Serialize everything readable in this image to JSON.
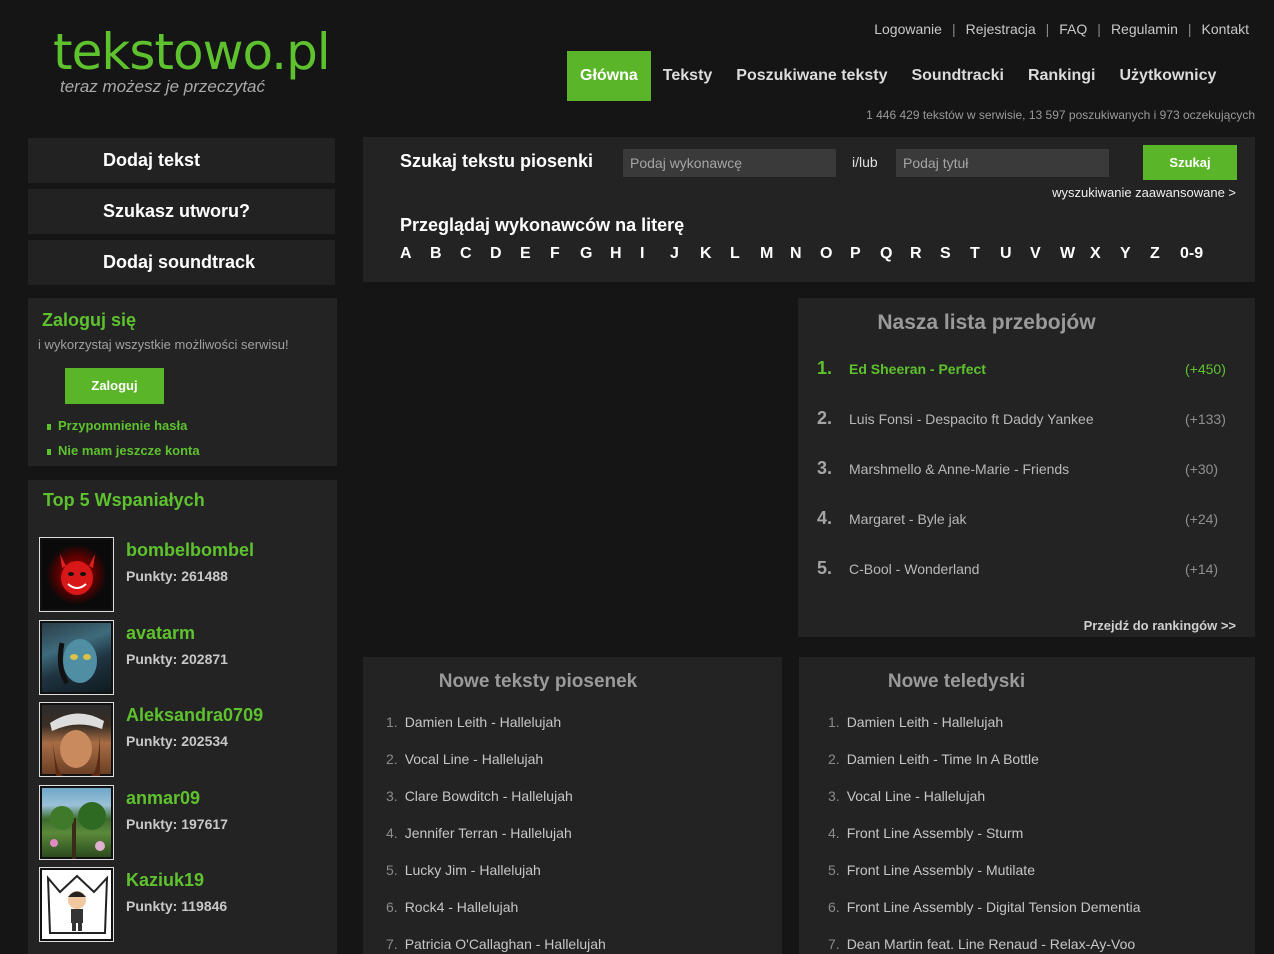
{
  "logo": {
    "title": "tekstowo.pl",
    "subtitle": "teraz możesz je przeczytać"
  },
  "toplinks": [
    "Logowanie",
    "Rejestracja",
    "FAQ",
    "Regulamin",
    "Kontakt"
  ],
  "nav": [
    "Główna",
    "Teksty",
    "Poszukiwane teksty",
    "Soundtracki",
    "Rankingi",
    "Użytkownicy"
  ],
  "stats": "1 446 429 tekstów w serwisie, 13 597 poszukiwanych i 973 oczekujących",
  "sidebar": {
    "buttons": [
      "Dodaj tekst",
      "Szukasz utworu?",
      "Dodaj soundtrack"
    ],
    "login": {
      "title": "Zaloguj się",
      "desc": "i wykorzystaj wszystkie możliwości serwisu!",
      "button": "Zaloguj",
      "links": [
        "Przypomnienie hasła",
        "Nie mam jeszcze konta"
      ]
    },
    "top5": {
      "title": "Top 5 Wspaniałych",
      "users": [
        {
          "name": "bombelbombel",
          "points": "Punkty: 261488"
        },
        {
          "name": "avatarm",
          "points": "Punkty: 202871"
        },
        {
          "name": "Aleksandra0709",
          "points": "Punkty: 202534"
        },
        {
          "name": "anmar09",
          "points": "Punkty: 197617"
        },
        {
          "name": "Kaziuk19",
          "points": "Punkty: 119846"
        }
      ]
    }
  },
  "search": {
    "title": "Szukaj tekstu piosenki",
    "artist_placeholder": "Podaj wykonawcę",
    "andor": "i/lub",
    "title_placeholder": "Podaj tytuł",
    "button": "Szukaj",
    "advanced": "wyszukiwanie zaawansowane >",
    "browse_title": "Przeglądaj wykonawców na literę",
    "letters": [
      "A",
      "B",
      "C",
      "D",
      "E",
      "F",
      "G",
      "H",
      "I",
      "J",
      "K",
      "L",
      "M",
      "N",
      "O",
      "P",
      "Q",
      "R",
      "S",
      "T",
      "U",
      "V",
      "W",
      "X",
      "Y",
      "Z",
      "0-9"
    ]
  },
  "hits": {
    "title": "Nasza lista przebojów",
    "items": [
      {
        "num": "1.",
        "title": "Ed Sheeran - Perfect",
        "change": "(+450)"
      },
      {
        "num": "2.",
        "title": "Luis Fonsi - Despacito ft Daddy Yankee",
        "change": "(+133)"
      },
      {
        "num": "3.",
        "title": "Marshmello & Anne-Marie - Friends",
        "change": "(+30)"
      },
      {
        "num": "4.",
        "title": "Margaret - Byle jak",
        "change": "(+24)"
      },
      {
        "num": "5.",
        "title": "C-Bool - Wonderland",
        "change": "(+14)"
      }
    ],
    "more": "Przejdź do rankingów >>"
  },
  "new_lyrics": {
    "title": "Nowe teksty piosenek",
    "items": [
      {
        "num": "1.",
        "title": "Damien Leith - Hallelujah"
      },
      {
        "num": "2.",
        "title": "Vocal Line - Hallelujah"
      },
      {
        "num": "3.",
        "title": "Clare Bowditch - Hallelujah"
      },
      {
        "num": "4.",
        "title": "Jennifer Terran - Hallelujah"
      },
      {
        "num": "5.",
        "title": "Lucky Jim - Hallelujah"
      },
      {
        "num": "6.",
        "title": "Rock4 - Hallelujah"
      },
      {
        "num": "7.",
        "title": "Patricia O'Callaghan - Hallelujah"
      }
    ]
  },
  "new_videos": {
    "title": "Nowe teledyski",
    "items": [
      {
        "num": "1.",
        "title": "Damien Leith - Hallelujah"
      },
      {
        "num": "2.",
        "title": "Damien Leith - Time In A Bottle"
      },
      {
        "num": "3.",
        "title": "Vocal Line - Hallelujah"
      },
      {
        "num": "4.",
        "title": "Front Line Assembly - Sturm"
      },
      {
        "num": "5.",
        "title": "Front Line Assembly - Mutilate"
      },
      {
        "num": "6.",
        "title": "Front Line Assembly - Digital Tension Dementia"
      },
      {
        "num": "7.",
        "title": "Dean Martin feat. Line Renaud - Relax-Ay-Voo"
      }
    ]
  },
  "colors": {
    "accent": "#5ab528",
    "link_green": "#5ec22f",
    "panel": "#232323",
    "background": "#151515"
  }
}
